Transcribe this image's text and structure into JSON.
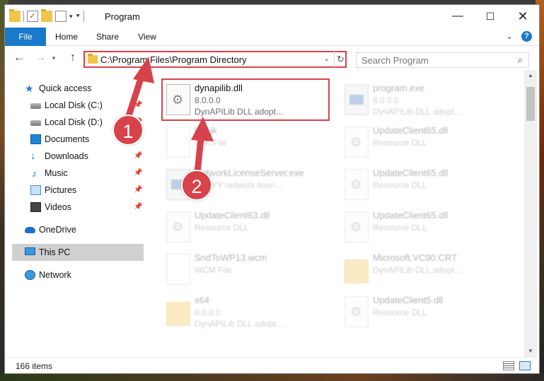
{
  "window": {
    "title": "Program",
    "controls": {
      "minimize": "—",
      "maximize": "☐",
      "close": "✕"
    }
  },
  "ribbon": {
    "tabs": [
      "File",
      "Home",
      "Share",
      "View"
    ],
    "help": "?"
  },
  "address": {
    "path": "C:\\Program Files\\Program Directory",
    "search_placeholder": "Search Program"
  },
  "navigation": {
    "quick_access": "Quick access",
    "pinned": [
      {
        "label": "Local Disk (C:)",
        "icon": "disk-icon"
      },
      {
        "label": "Local Disk (D:)",
        "icon": "disk-icon"
      },
      {
        "label": "Documents",
        "icon": "documents-icon"
      },
      {
        "label": "Downloads",
        "icon": "downloads-icon"
      },
      {
        "label": "Music",
        "icon": "music-icon"
      },
      {
        "label": "Pictures",
        "icon": "pictures-icon"
      },
      {
        "label": "Videos",
        "icon": "videos-icon"
      }
    ],
    "onedrive": "OneDrive",
    "this_pc": "This PC",
    "network": "Network"
  },
  "files": {
    "left": [
      {
        "name": "dynapilib.dll",
        "line2": "8.0.0.0",
        "line3": "DynAPILib DLL adopt...",
        "icon": "dll"
      },
      {
        "name": "lic.cjk",
        "line2": "CJK File",
        "line3": "",
        "icon": "plain"
      },
      {
        "name": "NetworkLicenseServer.exe",
        "line2": "ABBYY network licen...",
        "line3": "",
        "icon": "exe"
      },
      {
        "name": "UpdateClient63.dll",
        "line2": "Resource DLL",
        "line3": "",
        "icon": "dll"
      },
      {
        "name": "SndToWP13.wcm",
        "line2": "WCM File",
        "line3": "",
        "icon": "plain"
      },
      {
        "name": "x64",
        "line2": "8.0.0.0",
        "line3": "DynAPILib DLL adopt...",
        "icon": "folder"
      }
    ],
    "right": [
      {
        "name": "program.exe",
        "line2": "8.0.0.0",
        "line3": "DynAPILib DLL adopt...",
        "icon": "exe"
      },
      {
        "name": "UpdateClient65.dll",
        "line2": "Resource DLL",
        "line3": "",
        "icon": "dll"
      },
      {
        "name": "UpdateClient65.dll",
        "line2": "Resource DLL",
        "line3": "",
        "icon": "dll"
      },
      {
        "name": "UpdateClient65.dll",
        "line2": "Resource DLL",
        "line3": "",
        "icon": "dll"
      },
      {
        "name": "Microsoft.VC90.CRT",
        "line2": "DynAPILib DLL adopt...",
        "line3": "",
        "icon": "folder"
      },
      {
        "name": "UpdateClient5.dll",
        "line2": "Resource DLL",
        "line3": "",
        "icon": "dll"
      }
    ]
  },
  "status": {
    "count": "166 items"
  },
  "annotations": {
    "step1": "1",
    "step2": "2",
    "color": "#d8424b"
  }
}
